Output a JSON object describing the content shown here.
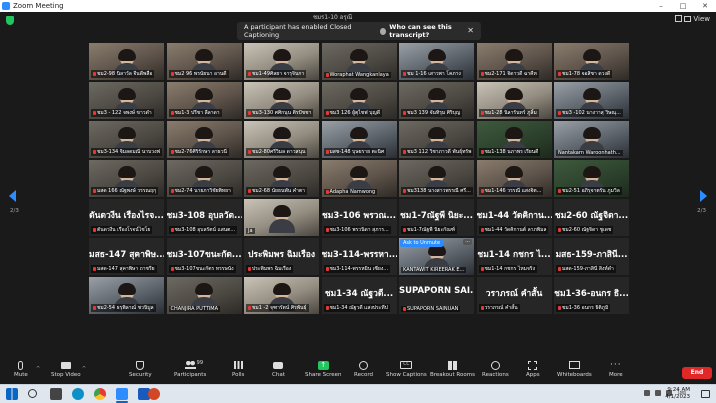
{
  "window": {
    "title": "Zoom Meeting",
    "controls": {
      "minimize": "–",
      "maximize": "□",
      "close": "✕"
    }
  },
  "top": {
    "view_label": "View",
    "cropped_name": "ชมร1-10 อรุณี"
  },
  "cc_banner": {
    "message": "A participant has enabled Closed Captioning",
    "link": "Who can see this transcript?",
    "close": "✕"
  },
  "pagination": {
    "left": "2/3",
    "right": "2/3"
  },
  "tiles": [
    {
      "type": "video",
      "style": "v2",
      "label": "ชม2-98 นิลาวัล จีนดีพลือ",
      "muted": true
    },
    {
      "type": "video",
      "style": "v2",
      "label": "ชม2 96 พรนัยนา อานดี",
      "muted": true
    },
    {
      "type": "video",
      "style": "v5",
      "label": "ชม1-49ศิลยา จารุจินกา",
      "muted": true
    },
    {
      "type": "video",
      "style": "v1",
      "label": "Woraphat Wangkanlaya",
      "muted": true
    },
    {
      "type": "video",
      "style": "v3",
      "label": "ชม 1-16 เสาวพา โคภาง",
      "muted": true
    },
    {
      "type": "video",
      "style": "v2",
      "label": "ชม2-171 จิดาวดี ฉาคีห",
      "muted": true
    },
    {
      "type": "video",
      "style": "v2",
      "label": "ชม1-78 จอสิชา ดวงดี",
      "muted": true
    },
    {
      "type": "video",
      "style": "v1",
      "label": "ชม3 - 122 จพงษ์ ขาวดำ",
      "muted": true
    },
    {
      "type": "video",
      "style": "v2",
      "label": "ชม1-3 ปรีชา ลีลาดา",
      "muted": true
    },
    {
      "type": "video",
      "style": "v5",
      "label": "ชม3-130 ศศิกนุน ติรปัชชา",
      "muted": true
    },
    {
      "type": "video",
      "style": "v1",
      "label": "ชม3 126 ผู้ตุไชฟ บุญดี",
      "muted": true
    },
    {
      "type": "video",
      "style": "v1",
      "label": "ชม3 139 จันทิรุม ศิริบุญ",
      "muted": true
    },
    {
      "type": "video",
      "style": "v5",
      "label": "ชม1-28 นิลารันทร์ ภูลิ้ม",
      "muted": true
    },
    {
      "type": "video",
      "style": "v3",
      "label": "ชม3 -102 นางาาสุ วิษณุ...",
      "muted": true
    },
    {
      "type": "video",
      "style": "v1",
      "label": "ชม3-134 จิมลดมณี นาบวงฟ",
      "muted": true
    },
    {
      "type": "video",
      "style": "v2",
      "label": "ชม2-76ศิริรักษา ลาธวนี",
      "muted": true
    },
    {
      "type": "video",
      "style": "v5",
      "label": "ชม2-80ศรีวิมล ดาวสนุน",
      "muted": true
    },
    {
      "type": "video",
      "style": "v3",
      "label": "มสช-148 บุษยราย ตะนิศ",
      "muted": true
    },
    {
      "type": "video",
      "style": "v1",
      "label": "ชม3 112 วิชาภาวดี พันธุ์ทรัพ",
      "muted": true
    },
    {
      "type": "video",
      "style": "v4",
      "label": "ชม1-138 นภาพร เรียนดี",
      "muted": true
    },
    {
      "type": "video",
      "style": "v3",
      "label": "Nantakarn Waroonhath...",
      "muted": false
    },
    {
      "type": "video",
      "style": "v1",
      "label": "มสด 166 ณัฐพงษ์ วรรณฤกุ",
      "muted": true
    },
    {
      "type": "video",
      "style": "v1",
      "label": "ชม2-74 นายภาวิชัยพิทยา",
      "muted": true
    },
    {
      "type": "video",
      "style": "v1",
      "label": "ชม2-68 นัยธนพัน คำตา",
      "muted": true
    },
    {
      "type": "video",
      "style": "v2",
      "label": "Adapha Namwong",
      "muted": true
    },
    {
      "type": "video",
      "style": "v1",
      "label": "ชม3138 นางสาวพรรณี ศรี...",
      "muted": true
    },
    {
      "type": "video",
      "style": "v2",
      "label": "ชม1-146 วรรณี แสงจิต...",
      "muted": true
    },
    {
      "type": "video",
      "style": "v4",
      "label": "ชม2-51 อภิรุจาตรัน ภูมวิล",
      "muted": true
    },
    {
      "type": "name",
      "bigname": "ดันดวงีน เรืองไรจ...",
      "label": "ตันดวงีน เรืองโรจน์ไชโย",
      "muted": true
    },
    {
      "type": "name",
      "bigname": "ชม3-108 อุบลวัต...",
      "label": "ชม3-108 อุบลรัตน์ แสนต...",
      "muted": true
    },
    {
      "type": "video",
      "style": "v5",
      "label": "Ja",
      "muted": false
    },
    {
      "type": "name",
      "bigname": "ชม3-106 พรวณ...",
      "label": "ชม3-106 พรวนิดา สุภาร...",
      "muted": true
    },
    {
      "type": "name",
      "bigname": "ชม1-7ณัฐพี นิยะ...",
      "label": "ชม1-7ณัฐพี นิยะกัณฑ์",
      "muted": true
    },
    {
      "type": "name",
      "bigname": "ชม1-44 วัดคิกาน...",
      "label": "ชม1-44 วัดคิกานต์ ลาภพิมล",
      "muted": true
    },
    {
      "type": "name",
      "bigname": "ชม2-60 ณัฐจิดา...",
      "label": "ชม2-60 ณัฐจิดา ชูเดช",
      "muted": true
    },
    {
      "type": "name",
      "bigname": "มสธ-147 สุคาพิษ...",
      "label": "มสด-147 สุคาพิษา ถาชรีย",
      "muted": true
    },
    {
      "type": "name",
      "bigname": "ชม3-107ขนะกัด...",
      "label": "ชม3-107ขนะกัตร ทรรษนัง",
      "muted": true
    },
    {
      "type": "name",
      "bigname": "ประพิมพร ฉิมเรือง",
      "label": "ประพิมพร ฉิมเรือง",
      "muted": true
    },
    {
      "type": "name",
      "bigname": "ชม3-114-พรรหา...",
      "label": "ชม3-114-พรรหมิน เซียง...",
      "muted": true
    },
    {
      "type": "video",
      "style": "v3",
      "label": "KANTAWIT KIREERAK E...",
      "muted": false,
      "overlay": true
    },
    {
      "type": "name",
      "bigname": "ชม1-14 กชกร ไ...",
      "label": "ชม1-14 กชกร ไหมจริง",
      "muted": true
    },
    {
      "type": "name",
      "bigname": "มสธ-159-ภาสินี...",
      "label": "มสด-159-ภาสินี สิงห์ดำ",
      "muted": true
    },
    {
      "type": "video",
      "style": "v3",
      "label": "ชม2-54 ธรุพิลาณ์ ชวนิบูล",
      "muted": true
    },
    {
      "type": "video",
      "style": "v1",
      "label": "CHANJIRA PUTTIMA",
      "muted": false
    },
    {
      "type": "video",
      "style": "v5",
      "label": "ชม1 -2 จุฑารัตน์ ศิรพันธุ์",
      "muted": true
    },
    {
      "type": "name",
      "bigname": "ชม1-34 ณัฐวดี...",
      "label": "ชม1-34 ณัฐวดี แสงประทีป",
      "muted": true
    },
    {
      "type": "name",
      "bigname": "SUPAPORN SAI...",
      "label": "SUPAPORN SAINUAN",
      "muted": true
    },
    {
      "type": "name",
      "bigname": "วราภรณ์ คำสั้น",
      "label": "วราภรณ์ คำสั้น",
      "muted": true
    },
    {
      "type": "name",
      "bigname": "ชม1-36-อนกร ธิ...",
      "label": "ชม1-36 อนกร ธิติภูมิ",
      "muted": true
    }
  ],
  "overlay": {
    "ask_unmute": "Ask to Unmute",
    "more": "···"
  },
  "toolbar": {
    "mute": "Mute",
    "stop_video": "Stop Video",
    "security": "Security",
    "participants": "Participants",
    "participants_count": "99",
    "polls": "Polls",
    "chat": "Chat",
    "share_screen": "Share Screen",
    "record": "Record",
    "show_captions": "Show Captions",
    "breakout_rooms": "Breakout Rooms",
    "reactions": "Reactions",
    "apps": "Apps",
    "whiteboards": "Whiteboards",
    "more": "More",
    "end": "End",
    "caret": "^",
    "cc_icon_text": "CC",
    "share_icon_text": "↑",
    "more_icon_text": "···"
  },
  "taskbar": {
    "time": "9:24 AM",
    "date": "4/1/2023",
    "lang": "ไทย"
  }
}
